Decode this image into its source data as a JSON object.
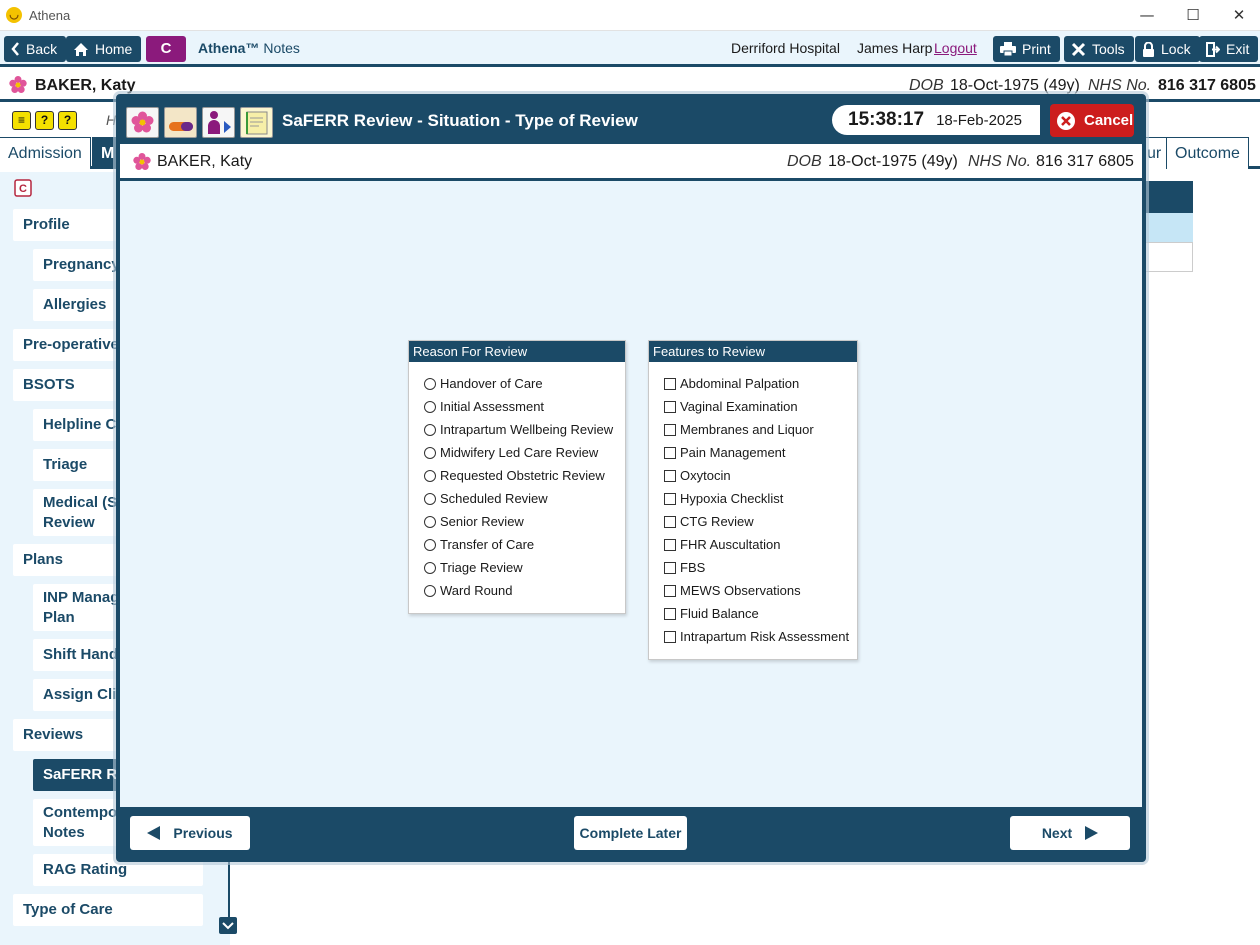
{
  "window": {
    "title": "Athena",
    "controls": [
      "—",
      "☐",
      "✕"
    ]
  },
  "topbar": {
    "back_label": "Back",
    "home_label": "Home",
    "logo_letter": "C",
    "app_name": "Athena™",
    "app_suffix": "Notes",
    "hospital": "Derriford Hospital",
    "user": "James Harp",
    "logout": "Logout",
    "print_label": "Print",
    "tools_label": "Tools",
    "lock_label": "Lock",
    "exit_label": "Exit"
  },
  "patient": {
    "name": "BAKER, Katy",
    "dob_label": "DOB",
    "dob": "18-Oct-1975 (49y)",
    "nhs_label": "NHS No.",
    "nhs": "816 317 6805"
  },
  "subbar": {
    "icons": [
      "≡",
      "?",
      "?"
    ],
    "partial_text": "H"
  },
  "tabs": {
    "admission": "Admission",
    "active": "M",
    "partial_right": "ur",
    "outcome": "Outcome"
  },
  "sidebar": {
    "items": [
      {
        "label": "Profile",
        "level": 0
      },
      {
        "label": "Pregnancy",
        "level": 1
      },
      {
        "label": "Allergies",
        "level": 1
      },
      {
        "label": "Pre-operative",
        "level": 0
      },
      {
        "label": "BSOTS",
        "level": 0
      },
      {
        "label": "Helpline Co",
        "level": 1
      },
      {
        "label": "Triage",
        "level": 1
      },
      {
        "label": "Medical (Sa",
        "label2": "Review",
        "level": 1
      },
      {
        "label": "Plans",
        "level": 0
      },
      {
        "label": "INP Manag",
        "label2": "Plan",
        "level": 1
      },
      {
        "label": "Shift Hando",
        "level": 1
      },
      {
        "label": "Assign Clin",
        "level": 1
      },
      {
        "label": "Reviews",
        "level": 0
      },
      {
        "label": "SaFERR Rev",
        "level": 1,
        "selected": true
      },
      {
        "label": "Contempor",
        "label2": "Notes",
        "level": 1
      },
      {
        "label": "RAG Rating",
        "level": 1
      },
      {
        "label": "Type of Care",
        "level": 0
      }
    ]
  },
  "modal": {
    "title": "SaFERR Review - Situation - Type of Review",
    "time": "15:38:17",
    "date": "18-Feb-2025",
    "cancel_label": "Cancel",
    "reason_panel": {
      "title": "Reason For Review",
      "options": [
        "Handover of Care",
        "Initial Assessment",
        "Intrapartum Wellbeing Review",
        "Midwifery Led Care Review",
        "Requested Obstetric Review",
        "Scheduled Review",
        "Senior Review",
        "Transfer of Care",
        "Triage Review",
        "Ward Round"
      ]
    },
    "features_panel": {
      "title": "Features to Review",
      "options": [
        "Abdominal Palpation",
        "Vaginal Examination",
        "Membranes and Liquor",
        "Pain Management",
        "Oxytocin",
        "Hypoxia Checklist",
        "CTG Review",
        "FHR Auscultation",
        "FBS",
        "MEWS Observations",
        "Fluid Balance",
        "Intrapartum Risk Assessment"
      ]
    },
    "footer": {
      "previous_label": "Previous",
      "complete_later_label": "Complete Later",
      "next_label": "Next"
    }
  },
  "colors": {
    "primary": "#1b4a67",
    "background": "#eaf5fc",
    "cancel": "#cc1d1d",
    "brand": "#8b1a7c"
  }
}
